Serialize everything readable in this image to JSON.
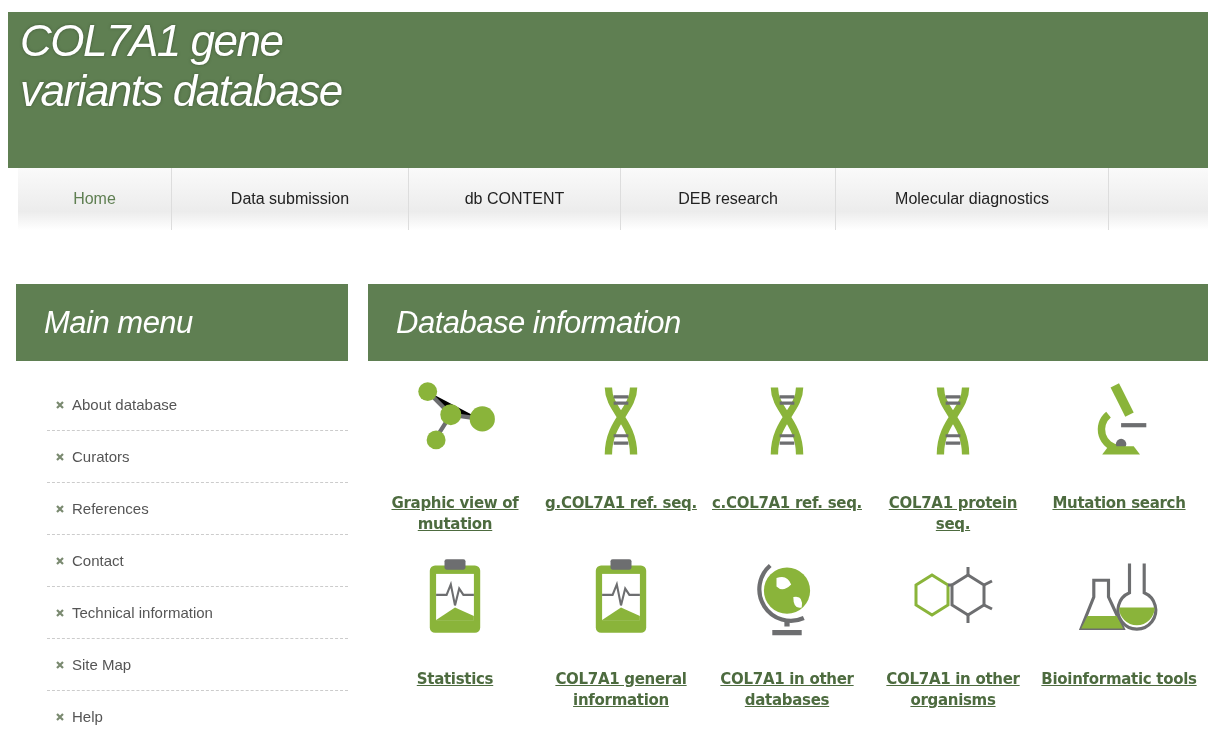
{
  "header": {
    "title_lines": [
      "COL7A1 gene",
      "variants database"
    ]
  },
  "nav": [
    {
      "label": "Home",
      "selected": true
    },
    {
      "label": "Data submission",
      "selected": false
    },
    {
      "label": "db CONTENT",
      "selected": false
    },
    {
      "label": "DEB research",
      "selected": false
    },
    {
      "label": "Molecular diagnostics",
      "selected": false
    }
  ],
  "main_menu": {
    "title": "Main menu",
    "items": [
      "About database",
      "Curators",
      "References",
      "Contact",
      "Technical information",
      "Site Map",
      "Help"
    ]
  },
  "database_information": {
    "title": "Database information",
    "tiles": [
      {
        "kind": "molecule",
        "label": "Graphic view of mutation"
      },
      {
        "kind": "dna",
        "label": "g.COL7A1 ref. seq."
      },
      {
        "kind": "dna",
        "label": "c.COL7A1 ref. seq."
      },
      {
        "kind": "dna",
        "label": "COL7A1 protein seq."
      },
      {
        "kind": "microscope",
        "label": "Mutation search"
      },
      {
        "kind": "clipboard",
        "label": "Statistics"
      },
      {
        "kind": "clipboard",
        "label": "COL7A1 general information"
      },
      {
        "kind": "globe",
        "label": "COL7A1 in other databases"
      },
      {
        "kind": "rings",
        "label": "COL7A1 in other organisms"
      },
      {
        "kind": "flasks",
        "label": "Bioinformatic tools"
      }
    ]
  }
}
